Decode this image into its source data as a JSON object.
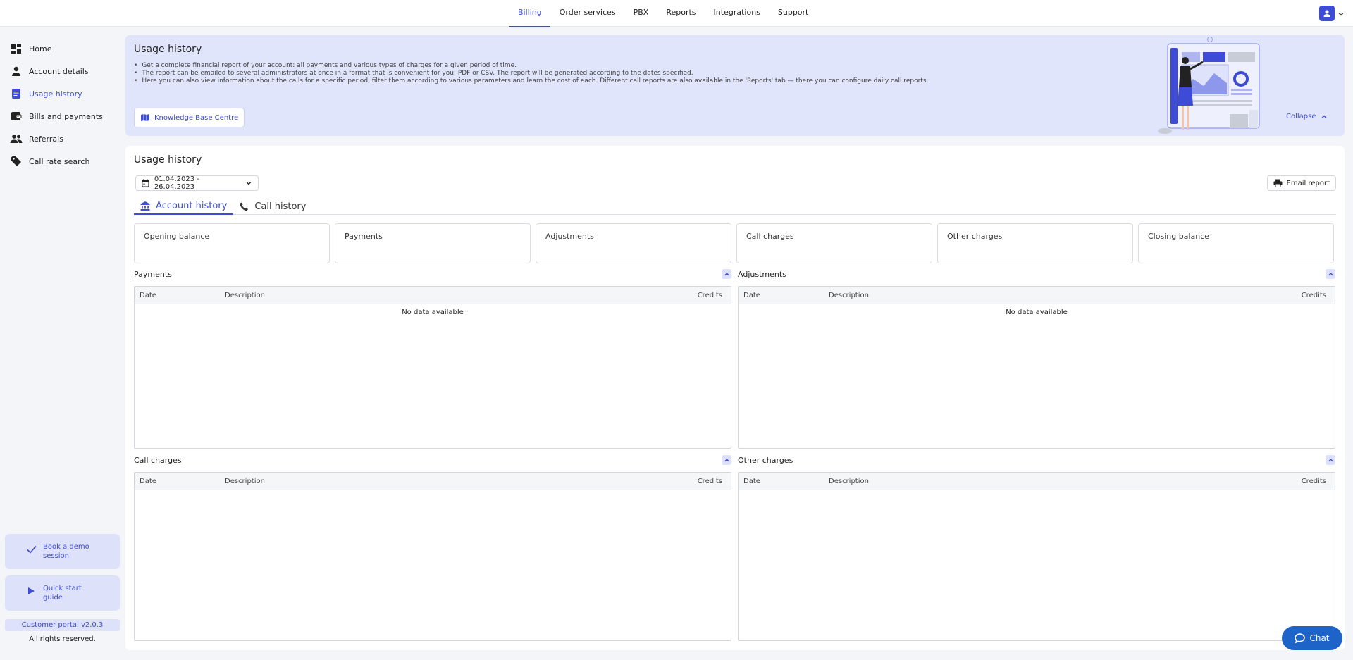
{
  "topnav": {
    "items": [
      {
        "label": "Billing",
        "active": true
      },
      {
        "label": "Order services"
      },
      {
        "label": "PBX"
      },
      {
        "label": "Reports"
      },
      {
        "label": "Integrations"
      },
      {
        "label": "Support"
      }
    ]
  },
  "sidebar": {
    "items": [
      {
        "label": "Home",
        "icon": "dashboard-icon"
      },
      {
        "label": "Account details",
        "icon": "person-icon"
      },
      {
        "label": "Usage history",
        "icon": "document-icon",
        "active": true
      },
      {
        "label": "Bills and payments",
        "icon": "wallet-icon"
      },
      {
        "label": "Referrals",
        "icon": "people-icon"
      },
      {
        "label": "Call rate search",
        "icon": "tag-icon"
      }
    ],
    "demo_label": "Book a demo session",
    "guide_label": "Quick start guide",
    "version": "Customer portal v2.0.3",
    "rights": "All rights reserved."
  },
  "banner": {
    "title": "Usage history",
    "bullets": [
      "Get a complete financial report of your account: all payments and various types of charges for a given period of time.",
      "The report can be emailed to several administrators at once in a format that is convenient for you: PDF or CSV. The report will be generated according to the dates specified.",
      "Here you can also view information about the calls for a specific period, filter them according to various parameters and learn the cost of each. Different call reports are also available in the 'Reports' tab — there you can configure daily call reports."
    ],
    "kb_button": "Knowledge Base Centre",
    "collapse_label": "Collapse"
  },
  "main": {
    "title": "Usage history",
    "date_range": "01.04.2023 - 26.04.2023",
    "email_button": "Email report",
    "tabs": [
      {
        "label": "Account history",
        "active": true
      },
      {
        "label": "Call history"
      }
    ],
    "cards": [
      "Opening balance",
      "Payments",
      "Adjustments",
      "Call charges",
      "Other charges",
      "Closing balance"
    ],
    "sections": {
      "payments": {
        "title": "Payments",
        "no_data": "No data available"
      },
      "adjustments": {
        "title": "Adjustments",
        "no_data": "No data available"
      },
      "call_charges": {
        "title": "Call charges"
      },
      "other_charges": {
        "title": "Other charges"
      }
    },
    "columns": {
      "date": "Date",
      "description": "Description",
      "credits": "Credits"
    }
  },
  "chat": {
    "label": "Chat"
  },
  "colors": {
    "accent": "#3d4bd6",
    "banner_bg": "#e1e5fb",
    "chat_bg": "#1e64c8"
  }
}
